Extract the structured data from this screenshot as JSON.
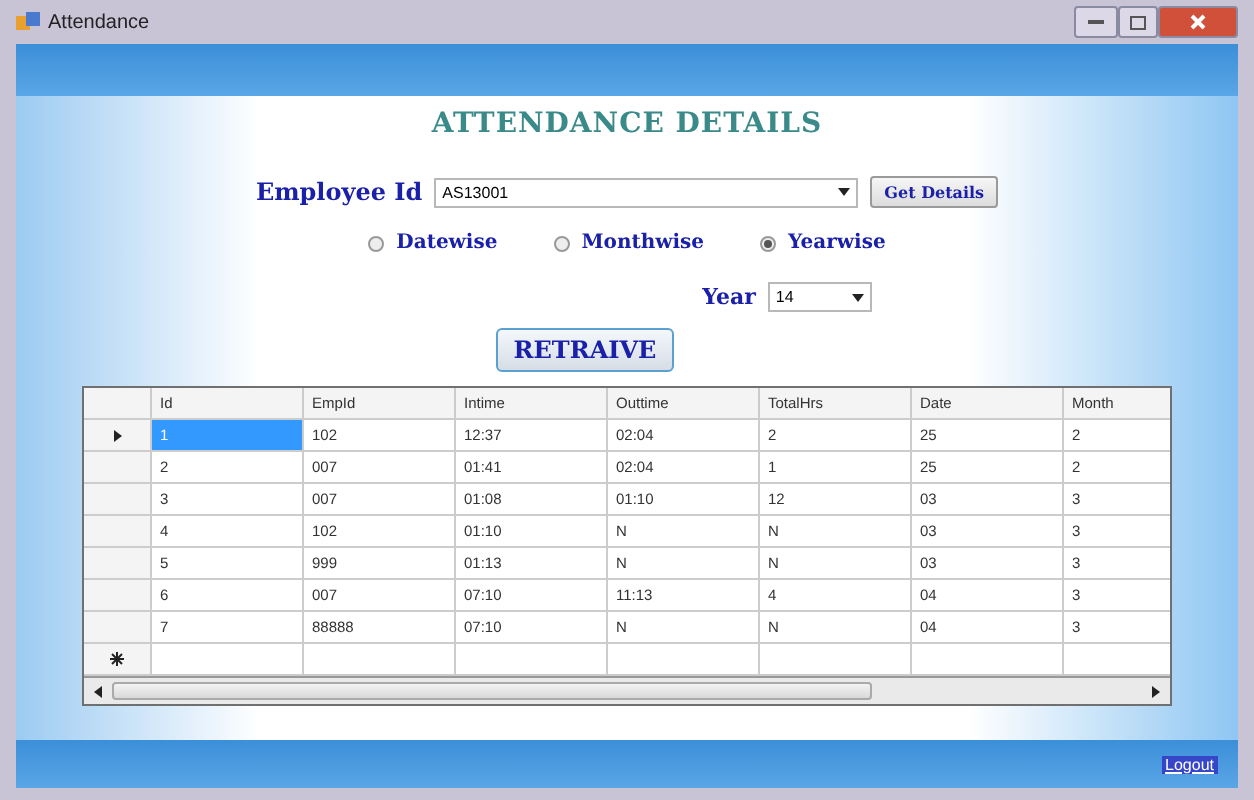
{
  "window": {
    "title": "Attendance"
  },
  "heading": "ATTENDANCE DETAILS",
  "employee": {
    "label": "Employee Id",
    "value": "AS13001",
    "button": "Get Details"
  },
  "modes": [
    {
      "label": "Datewise",
      "selected": false
    },
    {
      "label": "Monthwise",
      "selected": false
    },
    {
      "label": "Yearwise",
      "selected": true
    }
  ],
  "year": {
    "label": "Year",
    "value": "14"
  },
  "retrieve_button": "RETRAIVE",
  "table": {
    "columns": [
      "Id",
      "EmpId",
      "Intime",
      "Outtime",
      "TotalHrs",
      "Date",
      "Month"
    ],
    "rows": [
      {
        "selected": true,
        "cells": [
          "1",
          "102",
          "12:37",
          "02:04",
          "2",
          "25",
          "2"
        ]
      },
      {
        "selected": false,
        "cells": [
          "2",
          "007",
          "01:41",
          "02:04",
          "1",
          "25",
          "2"
        ]
      },
      {
        "selected": false,
        "cells": [
          "3",
          "007",
          "01:08",
          "01:10",
          "12",
          "03",
          "3"
        ]
      },
      {
        "selected": false,
        "cells": [
          "4",
          "102",
          "01:10",
          "N",
          "N",
          "03",
          "3"
        ]
      },
      {
        "selected": false,
        "cells": [
          "5",
          "999",
          "01:13",
          "N",
          "N",
          "03",
          "3"
        ]
      },
      {
        "selected": false,
        "cells": [
          "6",
          "007",
          "07:10",
          "11:13",
          "4",
          "04",
          "3"
        ]
      },
      {
        "selected": false,
        "cells": [
          "7",
          "88888",
          "07:10",
          "N",
          "N",
          "04",
          "3"
        ]
      }
    ]
  },
  "logout": "Logout"
}
